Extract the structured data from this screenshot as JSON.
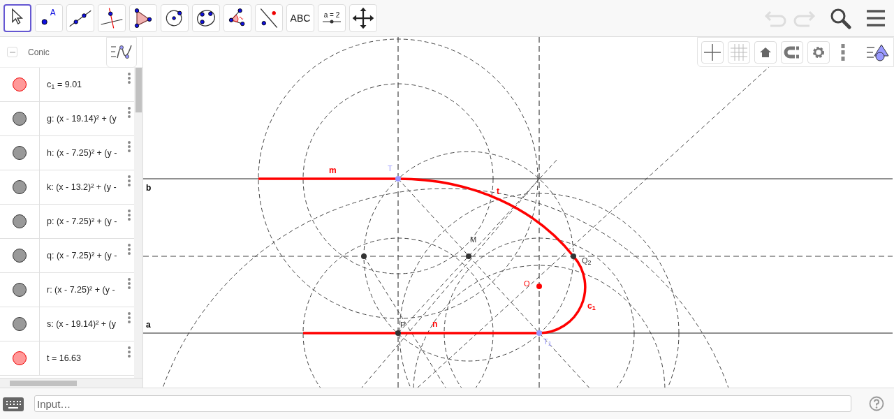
{
  "toolbar": {
    "tools": [
      {
        "kind": "move",
        "selected": true
      },
      {
        "kind": "point",
        "label": "A",
        "selected": false
      },
      {
        "kind": "line",
        "selected": false
      },
      {
        "kind": "perpendicular",
        "selected": false
      },
      {
        "kind": "polygon",
        "selected": false
      },
      {
        "kind": "circle",
        "selected": false
      },
      {
        "kind": "conic",
        "selected": false
      },
      {
        "kind": "angle",
        "selected": false
      },
      {
        "kind": "reflect",
        "selected": false
      },
      {
        "kind": "text",
        "label": "ABC",
        "selected": false
      },
      {
        "kind": "slider",
        "label": "a = 2",
        "selected": false
      },
      {
        "kind": "pan",
        "selected": false
      }
    ],
    "undo_enabled": false,
    "redo_enabled": false
  },
  "algebra": {
    "header": "Conic",
    "items": [
      {
        "text": "c$_{1}$ = 9.01",
        "color": "#ff9999"
      },
      {
        "text": "g: (x - 19.14)² + (y",
        "color": "#999999"
      },
      {
        "text": "h: (x - 7.25)² + (y -",
        "color": "#999999"
      },
      {
        "text": "k: (x - 13.2)² + (y -",
        "color": "#999999"
      },
      {
        "text": "p: (x - 7.25)² + (y -",
        "color": "#999999"
      },
      {
        "text": "q: (x - 7.25)² + (y -",
        "color": "#999999"
      },
      {
        "text": "r: (x - 7.25)² + (y -",
        "color": "#999999"
      },
      {
        "text": "s: (x - 19.14)² + (y",
        "color": "#999999"
      },
      {
        "text": "t = 16.63",
        "color": "#ff9999"
      }
    ]
  },
  "graphics": {
    "points": [
      {
        "label": "T",
        "color": "#9999ff"
      },
      {
        "label": "P",
        "color": "#333333"
      },
      {
        "label": "T$_{1}$",
        "color": "#9999ff"
      },
      {
        "label": "M",
        "color": "#333333"
      },
      {
        "label": "Q$_{2}$",
        "color": "#333333"
      },
      {
        "label": "O",
        "color": "#ff0000"
      }
    ],
    "object_labels": [
      {
        "text": "m",
        "color": "#ff0000"
      },
      {
        "text": "t",
        "color": "#ff0000"
      },
      {
        "text": "c$_{1}$",
        "color": "#ff0000"
      },
      {
        "text": "n",
        "color": "#ff0000"
      },
      {
        "text": "b",
        "color": "#000000"
      },
      {
        "text": "a",
        "color": "#000000"
      }
    ]
  },
  "input_bar": {
    "placeholder": "Input…"
  }
}
